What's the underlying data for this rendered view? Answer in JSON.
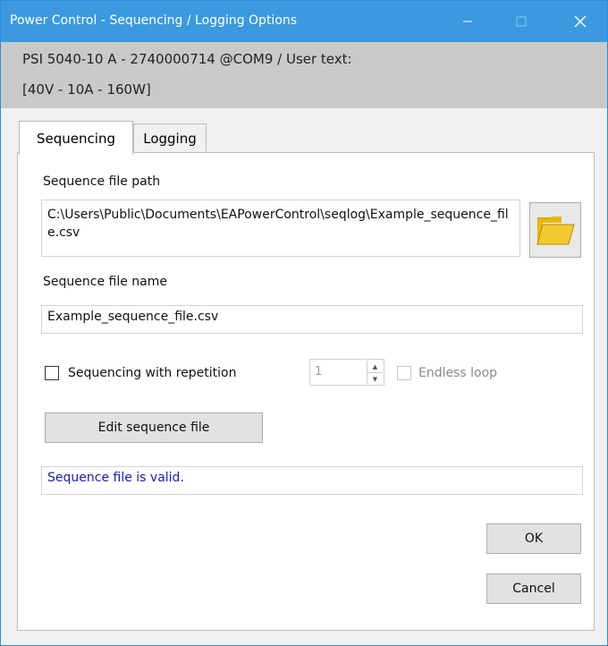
{
  "window": {
    "title": "Power Control - Sequencing / Logging Options",
    "minimize_icon": "minimize-icon",
    "maximize_icon": "maximize-icon",
    "close_icon": "close-icon"
  },
  "device": {
    "line1": "PSI 5040-10 A - 2740000714 @COM9 / User text:",
    "line2": "[40V - 10A - 160W]"
  },
  "tabs": [
    {
      "label": "Sequencing",
      "active": true
    },
    {
      "label": "Logging",
      "active": false
    }
  ],
  "sequencing": {
    "path_label": "Sequence file path",
    "path_value": "C:\\Users\\Public\\Documents\\EAPowerControl\\seqlog\\Example_sequence_file.csv",
    "folder_icon": "folder-open-icon",
    "name_label": "Sequence file name",
    "name_value": "Example_sequence_file.csv",
    "repetition_label": "Sequencing with repetition",
    "repetition_checked": false,
    "repetition_count": "1",
    "endless_label": "Endless loop",
    "endless_checked": false,
    "edit_button": "Edit sequence file",
    "status_text": "Sequence file is valid.",
    "status_color": "#1a1ab8"
  },
  "buttons": {
    "ok": "OK",
    "cancel": "Cancel"
  },
  "colors": {
    "titlebar": "#3b99e0",
    "infobar": "#c9c9c9"
  }
}
